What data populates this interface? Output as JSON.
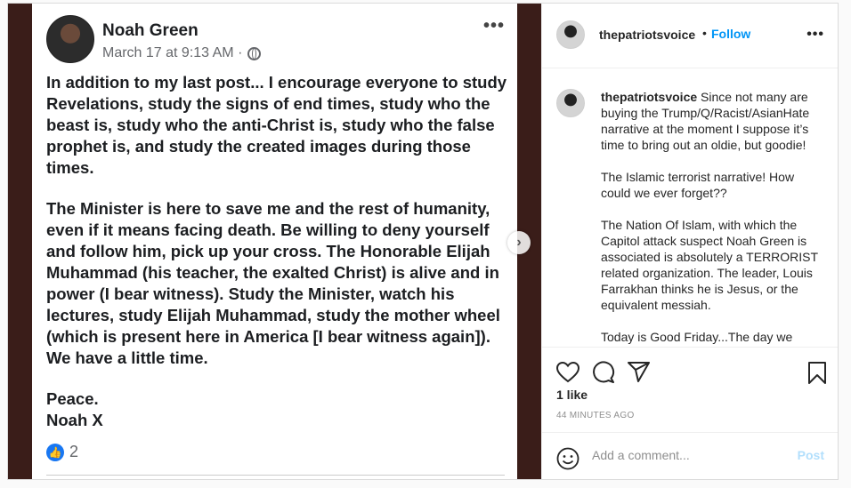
{
  "facebook_post": {
    "author": "Noah Green",
    "timestamp": "March 17 at 9:13 AM ·",
    "paragraphs": [
      "In addition to my last post... I encourage everyone to study Revelations, study the signs of end times, study who the beast is, study who the anti-Christ is, study who the false prophet is, and study the created images during those times.",
      "The Minister is here to save me and the rest of humanity, even if it means facing death. Be willing to deny yourself and follow him, pick up your cross. The Honorable Elijah Muhammad (his teacher, the exalted Christ) is alive and in power (I bear witness). Study the Minister, watch his lectures, study Elijah Muhammad, study the mother wheel (which is present here in America [I bear witness again]). We have a little time."
    ],
    "signoff": [
      "Peace.",
      "Noah X"
    ],
    "like_count": "2",
    "more_icon": "•••",
    "like_icon": "👍"
  },
  "carousel": {
    "next_icon": "›"
  },
  "instagram": {
    "username": "thepatriotsvoice",
    "separator": "•",
    "follow_label": "Follow",
    "more_icon": "•••",
    "caption_first": "Since not many are buying the Trump/Q/Racist/AsianHate narrative at the moment I suppose it’s time to bring out an oldie, but goodie!",
    "caption_paragraphs": [
      "The Islamic terrorist narrative! How could we ever forget??",
      "The Nation Of Islam, with which the Capitol attack suspect Noah Green is associated is absolutely a TERRORIST related organization. The leader, Louis Farrakhan thinks he is Jesus, or the equivalent messiah.",
      "Today is Good Friday...The day we"
    ],
    "likes_text": "1 like",
    "time_text": "44 MINUTES AGO",
    "comment_placeholder": "Add a comment...",
    "post_label": "Post",
    "accent_color": "#0095f6"
  }
}
